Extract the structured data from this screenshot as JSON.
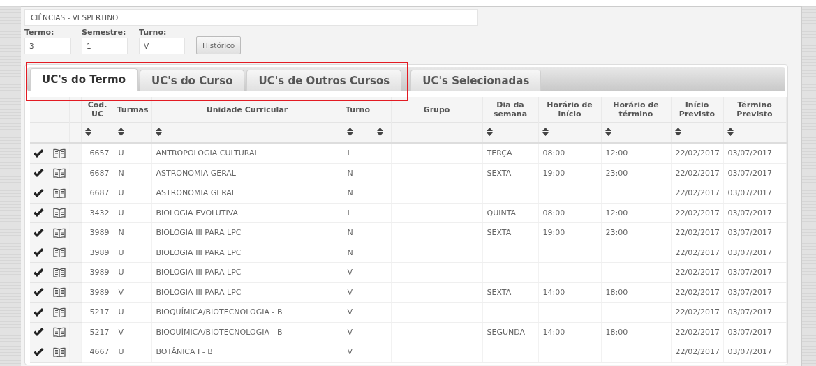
{
  "course": {
    "value": "CIÊNCIAS - VESPERTINO"
  },
  "filters": [
    {
      "label": "Termo:",
      "value": "3"
    },
    {
      "label": "Semestre:",
      "value": "1"
    },
    {
      "label": "Turno:",
      "value": "V"
    }
  ],
  "history_button": "Histórico",
  "tabs": [
    {
      "label": "UC's do Termo",
      "selected": true,
      "highlighted": true
    },
    {
      "label": "UC's do Curso",
      "selected": false,
      "highlighted": true
    },
    {
      "label": "UC's de Outros Cursos",
      "selected": false,
      "highlighted": true
    },
    {
      "label": "UC's Selecionadas",
      "selected": false,
      "highlighted": false
    }
  ],
  "table": {
    "columns": [
      {
        "kind": "action",
        "sortable": false
      },
      {
        "kind": "action",
        "sortable": false
      },
      {
        "kind": "blank",
        "sortable": false
      },
      {
        "kind": "num",
        "label": "Cod. UC",
        "sortable": true
      },
      {
        "kind": "text",
        "label": "Turmas",
        "sortable": true
      },
      {
        "kind": "text",
        "label": "Unidade Curricular",
        "sortable": true
      },
      {
        "kind": "text",
        "label": "Turno",
        "sortable": true
      },
      {
        "kind": "text",
        "sortable": true
      },
      {
        "kind": "text",
        "label": "Grupo",
        "sortable": false
      },
      {
        "kind": "text",
        "label": "Dia da semana",
        "sortable": true
      },
      {
        "kind": "text",
        "label": "Horário de início",
        "sortable": true
      },
      {
        "kind": "text",
        "label": "Horário de término",
        "sortable": true
      },
      {
        "kind": "text",
        "label": "Início Previsto",
        "sortable": true
      },
      {
        "kind": "text",
        "label": "Término Previsto",
        "sortable": true
      }
    ],
    "rows": [
      [
        "",
        "",
        "",
        "6657",
        "U",
        "ANTROPOLOGIA CULTURAL",
        "I",
        "",
        "",
        "TERÇA",
        "08:00",
        "12:00",
        "22/02/2017",
        "03/07/2017"
      ],
      [
        "",
        "",
        "",
        "6687",
        "N",
        "ASTRONOMIA GERAL",
        "N",
        "",
        "",
        "SEXTA",
        "19:00",
        "23:00",
        "22/02/2017",
        "03/07/2017"
      ],
      [
        "",
        "",
        "",
        "6687",
        "U",
        "ASTRONOMIA GERAL",
        "N",
        "",
        "",
        "",
        "",
        "",
        "22/02/2017",
        "03/07/2017"
      ],
      [
        "",
        "",
        "",
        "3432",
        "U",
        "BIOLOGIA EVOLUTIVA",
        "I",
        "",
        "",
        "QUINTA",
        "08:00",
        "12:00",
        "22/02/2017",
        "03/07/2017"
      ],
      [
        "",
        "",
        "",
        "3989",
        "N",
        "BIOLOGIA III PARA LPC",
        "N",
        "",
        "",
        "SEXTA",
        "19:00",
        "23:00",
        "22/02/2017",
        "03/07/2017"
      ],
      [
        "",
        "",
        "",
        "3989",
        "U",
        "BIOLOGIA III PARA LPC",
        "N",
        "",
        "",
        "",
        "",
        "",
        "22/02/2017",
        "03/07/2017"
      ],
      [
        "",
        "",
        "",
        "3989",
        "U",
        "BIOLOGIA III PARA LPC",
        "V",
        "",
        "",
        "",
        "",
        "",
        "22/02/2017",
        "03/07/2017"
      ],
      [
        "",
        "",
        "",
        "3989",
        "V",
        "BIOLOGIA III PARA LPC",
        "V",
        "",
        "",
        "SEXTA",
        "14:00",
        "18:00",
        "22/02/2017",
        "03/07/2017"
      ],
      [
        "",
        "",
        "",
        "5217",
        "U",
        "BIOQUÍMICA/BIOTECNOLOGIA - B",
        "V",
        "",
        "",
        "",
        "",
        "",
        "22/02/2017",
        "03/07/2017"
      ],
      [
        "",
        "",
        "",
        "5217",
        "V",
        "BIOQUÍMICA/BIOTECNOLOGIA - B",
        "V",
        "",
        "",
        "SEGUNDA",
        "14:00",
        "18:00",
        "22/02/2017",
        "03/07/2017"
      ],
      [
        "",
        "",
        "",
        "4667",
        "U",
        "BOTÂNICA I - B",
        "V",
        "",
        "",
        "",
        "",
        "",
        "22/02/2017",
        "03/07/2017"
      ]
    ]
  }
}
